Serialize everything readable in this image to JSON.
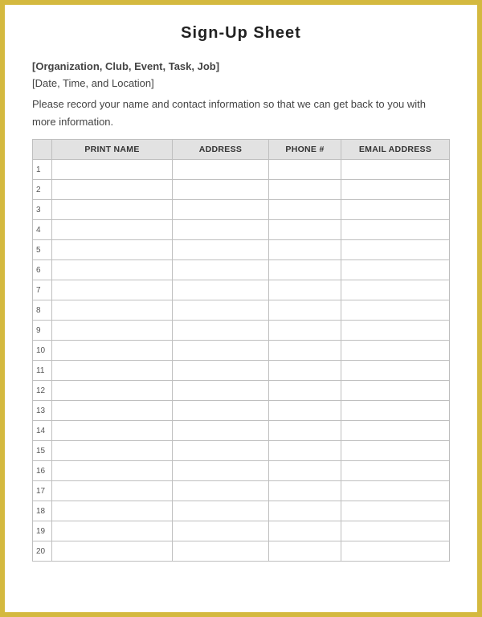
{
  "title": "Sign-Up  Sheet",
  "meta": {
    "line1": "[Organization, Club, Event, Task, Job]",
    "line2": "[Date, Time, and Location]"
  },
  "instructions": "Please record your name and contact information so that we can get back to you with more information.",
  "table": {
    "headers": {
      "num": "",
      "name": "PRINT NAME",
      "address": "ADDRESS",
      "phone": "PHONE #",
      "email": "EMAIL ADDRESS"
    },
    "rows": [
      {
        "n": "1",
        "name": "",
        "address": "",
        "phone": "",
        "email": ""
      },
      {
        "n": "2",
        "name": "",
        "address": "",
        "phone": "",
        "email": ""
      },
      {
        "n": "3",
        "name": "",
        "address": "",
        "phone": "",
        "email": ""
      },
      {
        "n": "4",
        "name": "",
        "address": "",
        "phone": "",
        "email": ""
      },
      {
        "n": "5",
        "name": "",
        "address": "",
        "phone": "",
        "email": ""
      },
      {
        "n": "6",
        "name": "",
        "address": "",
        "phone": "",
        "email": ""
      },
      {
        "n": "7",
        "name": "",
        "address": "",
        "phone": "",
        "email": ""
      },
      {
        "n": "8",
        "name": "",
        "address": "",
        "phone": "",
        "email": ""
      },
      {
        "n": "9",
        "name": "",
        "address": "",
        "phone": "",
        "email": ""
      },
      {
        "n": "10",
        "name": "",
        "address": "",
        "phone": "",
        "email": ""
      },
      {
        "n": "11",
        "name": "",
        "address": "",
        "phone": "",
        "email": ""
      },
      {
        "n": "12",
        "name": "",
        "address": "",
        "phone": "",
        "email": ""
      },
      {
        "n": "13",
        "name": "",
        "address": "",
        "phone": "",
        "email": ""
      },
      {
        "n": "14",
        "name": "",
        "address": "",
        "phone": "",
        "email": ""
      },
      {
        "n": "15",
        "name": "",
        "address": "",
        "phone": "",
        "email": ""
      },
      {
        "n": "16",
        "name": "",
        "address": "",
        "phone": "",
        "email": ""
      },
      {
        "n": "17",
        "name": "",
        "address": "",
        "phone": "",
        "email": ""
      },
      {
        "n": "18",
        "name": "",
        "address": "",
        "phone": "",
        "email": ""
      },
      {
        "n": "19",
        "name": "",
        "address": "",
        "phone": "",
        "email": ""
      },
      {
        "n": "20",
        "name": "",
        "address": "",
        "phone": "",
        "email": ""
      }
    ]
  }
}
